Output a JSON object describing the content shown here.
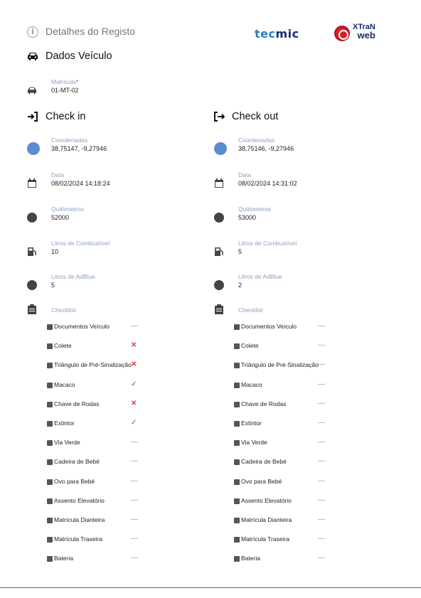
{
  "header": {
    "title": "Detalhes do Registo",
    "logo_tecmic_a": "tec",
    "logo_tecmic_b": "mic",
    "logo_xtran_1": "XTraN",
    "logo_xtran_2": "web"
  },
  "vehicle": {
    "section_title": "Dados Veículo",
    "plate_label": "Matrícula",
    "plate_required": "*",
    "plate_value": "01-MT-02"
  },
  "checkin": {
    "title": "Check in",
    "coords_label": "Coordenadas",
    "coords_value": "38,75147, -9,27946",
    "date_label": "Data",
    "date_value": "08/02/2024 14:18:24",
    "km_label": "Quilómetros",
    "km_value": "52000",
    "fuel_label": "Litros de Combustível",
    "fuel_value": "10",
    "adblue_label": "Litros de AdBlue",
    "adblue_value": "5",
    "checklist_label": "Checklist",
    "items": [
      {
        "label": "Documentos Veículo",
        "status": "—"
      },
      {
        "label": "Colete",
        "status": "✕"
      },
      {
        "label": "Triângulo de Pré-Sinalização",
        "status": "✕"
      },
      {
        "label": "Macaco",
        "status": "✓"
      },
      {
        "label": "Chave de Rodas",
        "status": "✕"
      },
      {
        "label": "Extintor",
        "status": "✓"
      },
      {
        "label": "Via Verde",
        "status": "—"
      },
      {
        "label": "Cadeira de Bebé",
        "status": "—"
      },
      {
        "label": "Ovo para Bebé",
        "status": "—"
      },
      {
        "label": "Assento Elevatório",
        "status": "—"
      },
      {
        "label": "Matrícula Dianteira",
        "status": "—"
      },
      {
        "label": "Matrícula Traseira",
        "status": "—"
      },
      {
        "label": "Bateria",
        "status": "—"
      }
    ]
  },
  "checkout": {
    "title": "Check out",
    "coords_label": "Coordenadas",
    "coords_value": "38,75146, -9,27946",
    "date_label": "Data",
    "date_value": "08/02/2024 14:31:02",
    "km_label": "Quilómetros",
    "km_value": "53000",
    "fuel_label": "Litros de Combustível",
    "fuel_value": "5",
    "adblue_label": "Litros de AdBlue",
    "adblue_value": "2",
    "checklist_label": "Checklist",
    "items": [
      {
        "label": "Documentos Veículo",
        "status": "—"
      },
      {
        "label": "Colete",
        "status": "—"
      },
      {
        "label": "Triângulo de Pré-Sinalização",
        "status": "—"
      },
      {
        "label": "Macaco",
        "status": "—"
      },
      {
        "label": "Chave de Rodas",
        "status": "—"
      },
      {
        "label": "Extintor",
        "status": "—"
      },
      {
        "label": "Via Verde",
        "status": "—"
      },
      {
        "label": "Cadeira de Bebé",
        "status": "—"
      },
      {
        "label": "Ovo para Bebé",
        "status": "—"
      },
      {
        "label": "Assento Elevatório",
        "status": "—"
      },
      {
        "label": "Matrícula Dianteira",
        "status": "—"
      },
      {
        "label": "Matrícula Traseira",
        "status": "—"
      },
      {
        "label": "Bateria",
        "status": "—"
      }
    ]
  },
  "colors": {
    "label": "#8ca0c2",
    "icon_blue": "#5b8ccf",
    "status_x": "#e53935",
    "status_check": "#5ab14a"
  }
}
